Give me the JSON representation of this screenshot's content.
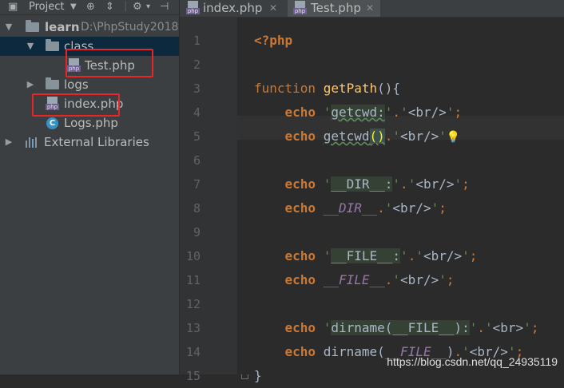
{
  "project_panel": {
    "title": "Project",
    "tree": [
      {
        "label": "learn",
        "hint": "D:\\PhpStudy2018"
      },
      {
        "label": "class"
      },
      {
        "label": "Test.php",
        "icon_tag": "php"
      },
      {
        "label": "logs"
      },
      {
        "label": "index.php",
        "icon_tag": "php"
      },
      {
        "label": "Logs.php",
        "icon_tag": "C"
      },
      {
        "label": "External Libraries"
      }
    ]
  },
  "tabs": [
    {
      "label": "index.php",
      "icon_tag": "php"
    },
    {
      "label": "Test.php",
      "icon_tag": "php"
    }
  ],
  "editor": {
    "line_numbers": [
      "1",
      "2",
      "3",
      "4",
      "5",
      "6",
      "7",
      "8",
      "9",
      "10",
      "11",
      "12",
      "13",
      "14",
      "15"
    ],
    "lines": [
      [
        {
          "t": "<?php",
          "c": "kw"
        }
      ],
      [],
      [
        {
          "t": "function ",
          "c": "kwn"
        },
        {
          "t": "getPath",
          "c": "fn"
        },
        {
          "t": "(){",
          "c": "paren"
        }
      ],
      [
        {
          "t": "    echo ",
          "c": "kw"
        },
        {
          "t": "'",
          "c": "str"
        },
        {
          "t": "getcwd:",
          "c": "strhi"
        },
        {
          "t": "'",
          "c": "str"
        },
        {
          "t": ".",
          "c": "kwn"
        },
        {
          "t": "'",
          "c": "str"
        },
        {
          "t": "<br/>",
          "c": "paren"
        },
        {
          "t": "'",
          "c": "str"
        },
        {
          "t": ";",
          "c": "kwn"
        }
      ],
      [
        {
          "t": "    echo ",
          "c": "kw"
        },
        {
          "t": "getcwd",
          "c": "paren"
        },
        {
          "t": "()",
          "c": "parenhi"
        },
        {
          "t": ".",
          "c": "kwn"
        },
        {
          "t": "'",
          "c": "str"
        },
        {
          "t": "<br/>",
          "c": "paren"
        },
        {
          "t": "'",
          "c": "str"
        },
        {
          "t": "💡",
          "c": "bulb"
        }
      ],
      [],
      [
        {
          "t": "    echo ",
          "c": "kw"
        },
        {
          "t": "'",
          "c": "str"
        },
        {
          "t": "__DIR__:",
          "c": "strhi"
        },
        {
          "t": "'",
          "c": "str"
        },
        {
          "t": ".",
          "c": "kwn"
        },
        {
          "t": "'",
          "c": "str"
        },
        {
          "t": "<br/>",
          "c": "paren"
        },
        {
          "t": "'",
          "c": "str"
        },
        {
          "t": ";",
          "c": "kwn"
        }
      ],
      [
        {
          "t": "    echo ",
          "c": "kw"
        },
        {
          "t": "__DIR__",
          "c": "const"
        },
        {
          "t": ".",
          "c": "kwn"
        },
        {
          "t": "'",
          "c": "str"
        },
        {
          "t": "<br/>",
          "c": "paren"
        },
        {
          "t": "'",
          "c": "str"
        },
        {
          "t": ";",
          "c": "kwn"
        }
      ],
      [],
      [
        {
          "t": "    echo ",
          "c": "kw"
        },
        {
          "t": "'",
          "c": "str"
        },
        {
          "t": "__FILE__:",
          "c": "strhi"
        },
        {
          "t": "'",
          "c": "str"
        },
        {
          "t": ".",
          "c": "kwn"
        },
        {
          "t": "'",
          "c": "str"
        },
        {
          "t": "<br/>",
          "c": "paren"
        },
        {
          "t": "'",
          "c": "str"
        },
        {
          "t": ";",
          "c": "kwn"
        }
      ],
      [
        {
          "t": "    echo ",
          "c": "kw"
        },
        {
          "t": "__FILE__",
          "c": "const"
        },
        {
          "t": ".",
          "c": "kwn"
        },
        {
          "t": "'",
          "c": "str"
        },
        {
          "t": "<br/>",
          "c": "paren"
        },
        {
          "t": "'",
          "c": "str"
        },
        {
          "t": ";",
          "c": "kwn"
        }
      ],
      [],
      [
        {
          "t": "    echo ",
          "c": "kw"
        },
        {
          "t": "'",
          "c": "str"
        },
        {
          "t": "dirname(__FILE__):",
          "c": "strhi"
        },
        {
          "t": "'",
          "c": "str"
        },
        {
          "t": ".",
          "c": "kwn"
        },
        {
          "t": "'",
          "c": "str"
        },
        {
          "t": "<br>",
          "c": "paren"
        },
        {
          "t": "'",
          "c": "str"
        },
        {
          "t": ";",
          "c": "kwn"
        }
      ],
      [
        {
          "t": "    echo ",
          "c": "kw"
        },
        {
          "t": "dirname",
          "c": "paren"
        },
        {
          "t": "(",
          "c": "paren"
        },
        {
          "t": "__FILE__",
          "c": "const"
        },
        {
          "t": ")",
          "c": "paren"
        },
        {
          "t": ".",
          "c": "kwn"
        },
        {
          "t": "'",
          "c": "str"
        },
        {
          "t": "<br/>",
          "c": "paren"
        },
        {
          "t": "'",
          "c": "str"
        },
        {
          "t": ";",
          "c": "kwn"
        }
      ],
      [
        {
          "t": "}",
          "c": "paren"
        }
      ]
    ]
  },
  "watermark": "https://blog.csdn.net/qq_24935119",
  "colors": {
    "highlight_box": "#e8262a",
    "selection": "#0d293e",
    "keyword": "#cc7832",
    "function": "#ffc66d",
    "string": "#6a8759",
    "constant": "#9876aa"
  }
}
